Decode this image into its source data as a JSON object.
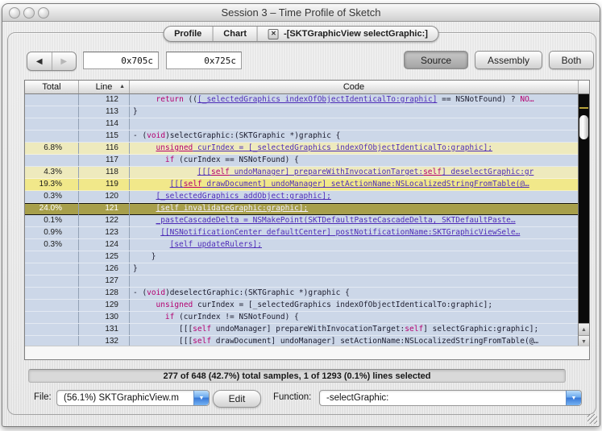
{
  "window": {
    "title": "Session 3 – Time Profile of Sketch"
  },
  "tabs": [
    {
      "label": "Profile",
      "active": false,
      "closable": false
    },
    {
      "label": "Chart",
      "active": false,
      "closable": false
    },
    {
      "label": "-[SKTGraphicView selectGraphic:]",
      "active": true,
      "closable": true,
      "close_glyph": "✕"
    }
  ],
  "toolbar": {
    "back_glyph": "◀",
    "forward_glyph": "▶",
    "address_start": "0x705c",
    "address_end": "0x725c",
    "view_buttons": [
      {
        "label": "Source",
        "selected": true
      },
      {
        "label": "Assembly",
        "selected": false
      },
      {
        "label": "Both",
        "selected": false
      }
    ]
  },
  "table": {
    "columns": {
      "total": "Total",
      "line": "Line",
      "code": "Code"
    },
    "sort": {
      "column": "Line",
      "direction": "ascending",
      "glyph": "▲"
    },
    "rows": [
      {
        "total": "",
        "line": "112",
        "bg": "blue",
        "indent": 5,
        "code": [
          [
            "kw",
            "return"
          ],
          [
            "pln",
            " (("
          ],
          [
            "lnk",
            "[_selectedGraphics indexOfObjectIdenticalTo:graphic]"
          ],
          [
            "pln",
            " == NSNotFound) ? "
          ],
          [
            "kw",
            "NO…"
          ]
        ]
      },
      {
        "total": "",
        "line": "113",
        "bg": "blue",
        "indent": 0,
        "code": [
          [
            "pln",
            "}"
          ]
        ]
      },
      {
        "total": "",
        "line": "114",
        "bg": "blue",
        "indent": 0,
        "code": []
      },
      {
        "total": "",
        "line": "115",
        "bg": "blue",
        "indent": 0,
        "code": [
          [
            "pln",
            "- ("
          ],
          [
            "kw",
            "void"
          ],
          [
            "pln",
            ")selectGraphic:(SKTGraphic *)graphic {"
          ]
        ]
      },
      {
        "total": "6.8%",
        "line": "116",
        "bg": "y1",
        "indent": 5,
        "code": [
          [
            "kwu",
            "unsigned"
          ],
          [
            "lnk",
            " curIndex = [_selectedGraphics indexOfObjectIdenticalTo:graphic];"
          ]
        ]
      },
      {
        "total": "",
        "line": "117",
        "bg": "blue",
        "indent": 7,
        "code": [
          [
            "kw",
            "if"
          ],
          [
            "pln",
            " (curIndex == NSNotFound) {"
          ]
        ]
      },
      {
        "total": "4.3%",
        "line": "118",
        "bg": "y1",
        "indent": 14,
        "code": [
          [
            "lnk",
            "[[["
          ],
          [
            "kwu",
            "self"
          ],
          [
            "lnk",
            " undoManager] prepareWithInvocationTarget:"
          ],
          [
            "kwu",
            "self"
          ],
          [
            "lnk",
            "] deselectGraphic:gr"
          ]
        ]
      },
      {
        "total": "19.3%",
        "line": "119",
        "bg": "y2",
        "indent": 8,
        "code": [
          [
            "lnk",
            "[[["
          ],
          [
            "kwu",
            "self"
          ],
          [
            "lnk",
            " drawDocument] undoManager] setActionName:NSLocalizedStringFromTable(@…"
          ]
        ]
      },
      {
        "total": "0.3%",
        "line": "120",
        "bg": "blue",
        "indent": 5,
        "code": [
          [
            "lnk",
            "[_selectedGraphics addObject:graphic];"
          ]
        ]
      },
      {
        "total": "24.0%",
        "line": "121",
        "bg": "sel",
        "indent": 5,
        "code": [
          [
            "lnk",
            "[self invalidateGraphic:graphic];"
          ]
        ]
      },
      {
        "total": "0.1%",
        "line": "122",
        "bg": "blue",
        "indent": 5,
        "code": [
          [
            "lnk",
            "_pasteCascadeDelta = NSMakePoint(SKTDefaultPasteCascadeDelta, SKTDefaultPaste…"
          ]
        ]
      },
      {
        "total": "0.9%",
        "line": "123",
        "bg": "blue",
        "indent": 6,
        "code": [
          [
            "lnk",
            "[[NSNotificationCenter defaultCenter] postNotificationName:SKTGraphicViewSele…"
          ]
        ]
      },
      {
        "total": "0.3%",
        "line": "124",
        "bg": "blue",
        "indent": 8,
        "code": [
          [
            "lnk",
            "[self updateRulers];"
          ]
        ]
      },
      {
        "total": "",
        "line": "125",
        "bg": "blue",
        "indent": 4,
        "code": [
          [
            "pln",
            "}"
          ]
        ]
      },
      {
        "total": "",
        "line": "126",
        "bg": "blue",
        "indent": 0,
        "code": [
          [
            "pln",
            "}"
          ]
        ]
      },
      {
        "total": "",
        "line": "127",
        "bg": "blue",
        "indent": 0,
        "code": []
      },
      {
        "total": "",
        "line": "128",
        "bg": "blue",
        "indent": 0,
        "code": [
          [
            "pln",
            "- ("
          ],
          [
            "kw",
            "void"
          ],
          [
            "pln",
            ")deselectGraphic:(SKTGraphic *)graphic {"
          ]
        ]
      },
      {
        "total": "",
        "line": "129",
        "bg": "blue",
        "indent": 5,
        "code": [
          [
            "kw",
            "unsigned"
          ],
          [
            "pln",
            " curIndex = [_selectedGraphics indexOfObjectIdenticalTo:graphic];"
          ]
        ]
      },
      {
        "total": "",
        "line": "130",
        "bg": "blue",
        "indent": 7,
        "code": [
          [
            "kw",
            "if"
          ],
          [
            "pln",
            " (curIndex != NSNotFound) {"
          ]
        ]
      },
      {
        "total": "",
        "line": "131",
        "bg": "blue",
        "indent": 10,
        "code": [
          [
            "pln",
            "[[["
          ],
          [
            "kw",
            "self"
          ],
          [
            "pln",
            " undoManager] prepareWithInvocationTarget:"
          ],
          [
            "kw",
            "self"
          ],
          [
            "pln",
            "] selectGraphic:graphic];"
          ]
        ]
      },
      {
        "total": "",
        "line": "132",
        "bg": "blue",
        "indent": 10,
        "code": [
          [
            "pln",
            "[[["
          ],
          [
            "kw",
            "self"
          ],
          [
            "pln",
            " drawDocument] undoManager] setActionName:NSLocalizedStringFromTable(@…"
          ]
        ]
      }
    ]
  },
  "scrollbar": {
    "up_glyph": "▲",
    "down_glyph": "▼",
    "marker_color": "#b7a23a"
  },
  "status_bar": {
    "text": "277 of 648 (42.7%) total samples, 1 of 1293 (0.1%) lines selected"
  },
  "footer": {
    "file_label": "File:",
    "file_value": "(56.1%) SKTGraphicView.m",
    "edit_label": "Edit",
    "function_label": "Function:",
    "function_value": "-selectGraphic:",
    "dropdown_glyph": "▼"
  },
  "colors": {
    "row_default": "#ccd7e8",
    "row_hot_low": "#eeeabd",
    "row_hot_high": "#f1e88a",
    "row_selected": "#a79f4b",
    "code_link": "#4f2db8",
    "code_keyword": "#b40070",
    "aqua_dropdown": "#3878d8"
  }
}
